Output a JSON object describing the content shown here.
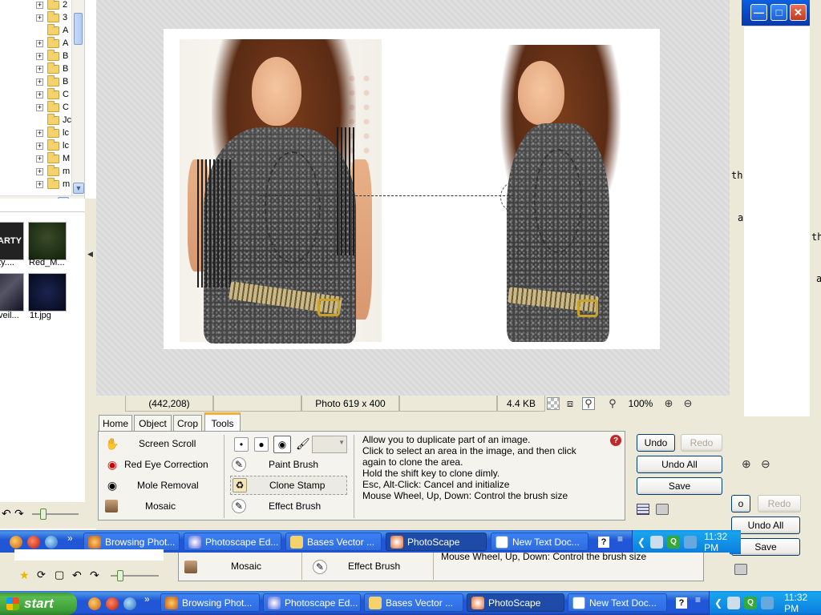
{
  "bg_window": {
    "snippets": [
      "th",
      "a",
      "th",
      "a"
    ],
    "buttons": {
      "undo": "o",
      "redo": "Redo",
      "undo_all": "Undo All",
      "save": "Save"
    }
  },
  "explorer": {
    "folders": [
      {
        "label": "2",
        "expandable": true
      },
      {
        "label": "3",
        "expandable": true
      },
      {
        "label": "A",
        "expandable": false
      },
      {
        "label": "A",
        "expandable": true
      },
      {
        "label": "B",
        "expandable": true
      },
      {
        "label": "B",
        "expandable": true
      },
      {
        "label": "B",
        "expandable": true
      },
      {
        "label": "C",
        "expandable": true
      },
      {
        "label": "C",
        "expandable": true
      },
      {
        "label": "Jc",
        "expandable": false
      },
      {
        "label": "lc",
        "expandable": true
      },
      {
        "label": "lc",
        "expandable": true
      },
      {
        "label": "M",
        "expandable": true
      },
      {
        "label": "m",
        "expandable": true
      },
      {
        "label": "m",
        "expandable": true
      }
    ],
    "thumbnails": [
      {
        "caption": "ty....",
        "art": "ARTY"
      },
      {
        "caption": "Red_M...",
        "art": ""
      },
      {
        "caption": "veil...",
        "art": ""
      },
      {
        "caption": "1t.jpg",
        "art": ""
      }
    ]
  },
  "statusbar": {
    "coords": "(442,208)",
    "photo_info": "Photo 619 x 400",
    "file_size": "4.4 KB",
    "zoom": "100%"
  },
  "tabs": [
    {
      "label": "Home",
      "active": false
    },
    {
      "label": "Object",
      "active": false
    },
    {
      "label": "Crop",
      "active": false
    },
    {
      "label": "Tools",
      "active": true
    }
  ],
  "tools": {
    "left": [
      {
        "label": "Screen Scroll",
        "icon": "hand-icon"
      },
      {
        "label": "Red Eye Correction",
        "icon": "eye-icon"
      },
      {
        "label": "Mole Removal",
        "icon": "dot-icon"
      },
      {
        "label": "Mosaic",
        "icon": "mosaic-icon"
      }
    ],
    "right": [
      {
        "label": "Paint Brush",
        "icon": "brush-icon"
      },
      {
        "label": "Clone Stamp",
        "icon": "stamp-icon",
        "selected": true
      },
      {
        "label": "Effect Brush",
        "icon": "effect-brush-icon"
      }
    ],
    "description": [
      "Allow you to duplicate part of an image.",
      "Click to select an area in the image, and then click",
      "again to clone the area.",
      "Hold the shift key to clone dimly.",
      "Esc, Alt-Click: Cancel and initialize",
      "Mouse Wheel, Up, Down: Control the brush size"
    ],
    "buttons": {
      "undo": "Undo",
      "redo": "Redo",
      "undo_all": "Undo All",
      "save": "Save"
    }
  },
  "ghost": {
    "mosaic": "Mosaic",
    "effect_brush": "Effect Brush",
    "desc_line": "Mouse Wheel, Up, Down: Control the brush size"
  },
  "taskbar_top": {
    "items": [
      "Browsing Phot...",
      "Photoscape Ed...",
      "Bases  Vector ...",
      "PhotoScape",
      "New Text Doc..."
    ],
    "active_index": 3,
    "clock": "11:32 PM"
  },
  "taskbar_bottom": {
    "start": "start",
    "items": [
      "Browsing Phot...",
      "Photoscape Ed...",
      "Bases  Vector ...",
      "PhotoScape",
      "New Text Doc..."
    ],
    "active_index": 3,
    "clock": "11:32 PM"
  },
  "colors": {
    "taskbar": "#2157d7",
    "start": "#3c9f37",
    "panel": "#ece9d8",
    "tab_accent": "#f2b23a"
  }
}
